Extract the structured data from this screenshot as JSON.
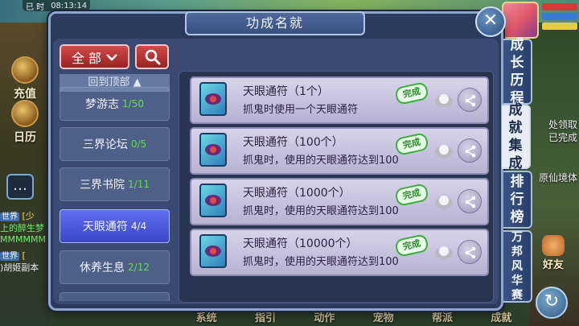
{
  "status_bar": {
    "left_text": "已 时",
    "time": "08:13:14"
  },
  "left_buttons": {
    "recharge": "充值",
    "calendar": "日历"
  },
  "chat": {
    "lines": [
      {
        "tag": "世界",
        "text": "[少",
        "color": "c-yellow"
      },
      {
        "tag": "",
        "text": "上的醉生梦",
        "color": "c-green"
      },
      {
        "tag": "",
        "text": "MMMMMMM",
        "color": "c-green"
      },
      {
        "tag": "世界",
        "text": "[",
        "color": "c-yellow"
      },
      {
        "tag": "",
        "text": ")胡姬副本",
        "color": "c-white"
      }
    ]
  },
  "right_fragments": {
    "collect": "处领取",
    "completed": "已完成",
    "realm": "原仙境体"
  },
  "bottom_bar": [
    "系统",
    "指引",
    "动作",
    "宠物",
    "帮派",
    "成就"
  ],
  "friend_button": "好友",
  "dialog": {
    "title": "功成名就",
    "filter": {
      "selected": "全 部"
    },
    "back_to_top": "回到顶部",
    "categories": [
      {
        "name": "梦游志",
        "count": "1/50",
        "active": false
      },
      {
        "name": "三界论坛",
        "count": "0/5",
        "active": false
      },
      {
        "name": "三界书院",
        "count": "1/11",
        "active": false
      },
      {
        "name": "天眼通符",
        "count": "4/4",
        "active": true
      },
      {
        "name": "休养生息",
        "count": "2/12",
        "active": false
      }
    ],
    "achievements": [
      {
        "name": "天眼通符（1个）",
        "desc": "抓鬼时使用一个天眼通符",
        "badge": "完成"
      },
      {
        "name": "天眼通符（100个）",
        "desc": "抓鬼时，使用的天眼通符达到100",
        "badge": "完成"
      },
      {
        "name": "天眼通符（1000个）",
        "desc": "抓鬼时，使用的天眼通符达到100",
        "badge": "完成"
      },
      {
        "name": "天眼通符（10000个）",
        "desc": "抓鬼时，使用的天眼通符达到100",
        "badge": "完成"
      }
    ],
    "side_tabs": [
      "成长历程",
      "成就集成",
      "排行榜",
      "万邦风华赛"
    ],
    "active_tab": 1
  },
  "colors": {
    "accent_red": "#c43a3a",
    "active_blue": "#4a5be0",
    "done_green": "#38b03a",
    "count_green": "#5fe04a"
  }
}
